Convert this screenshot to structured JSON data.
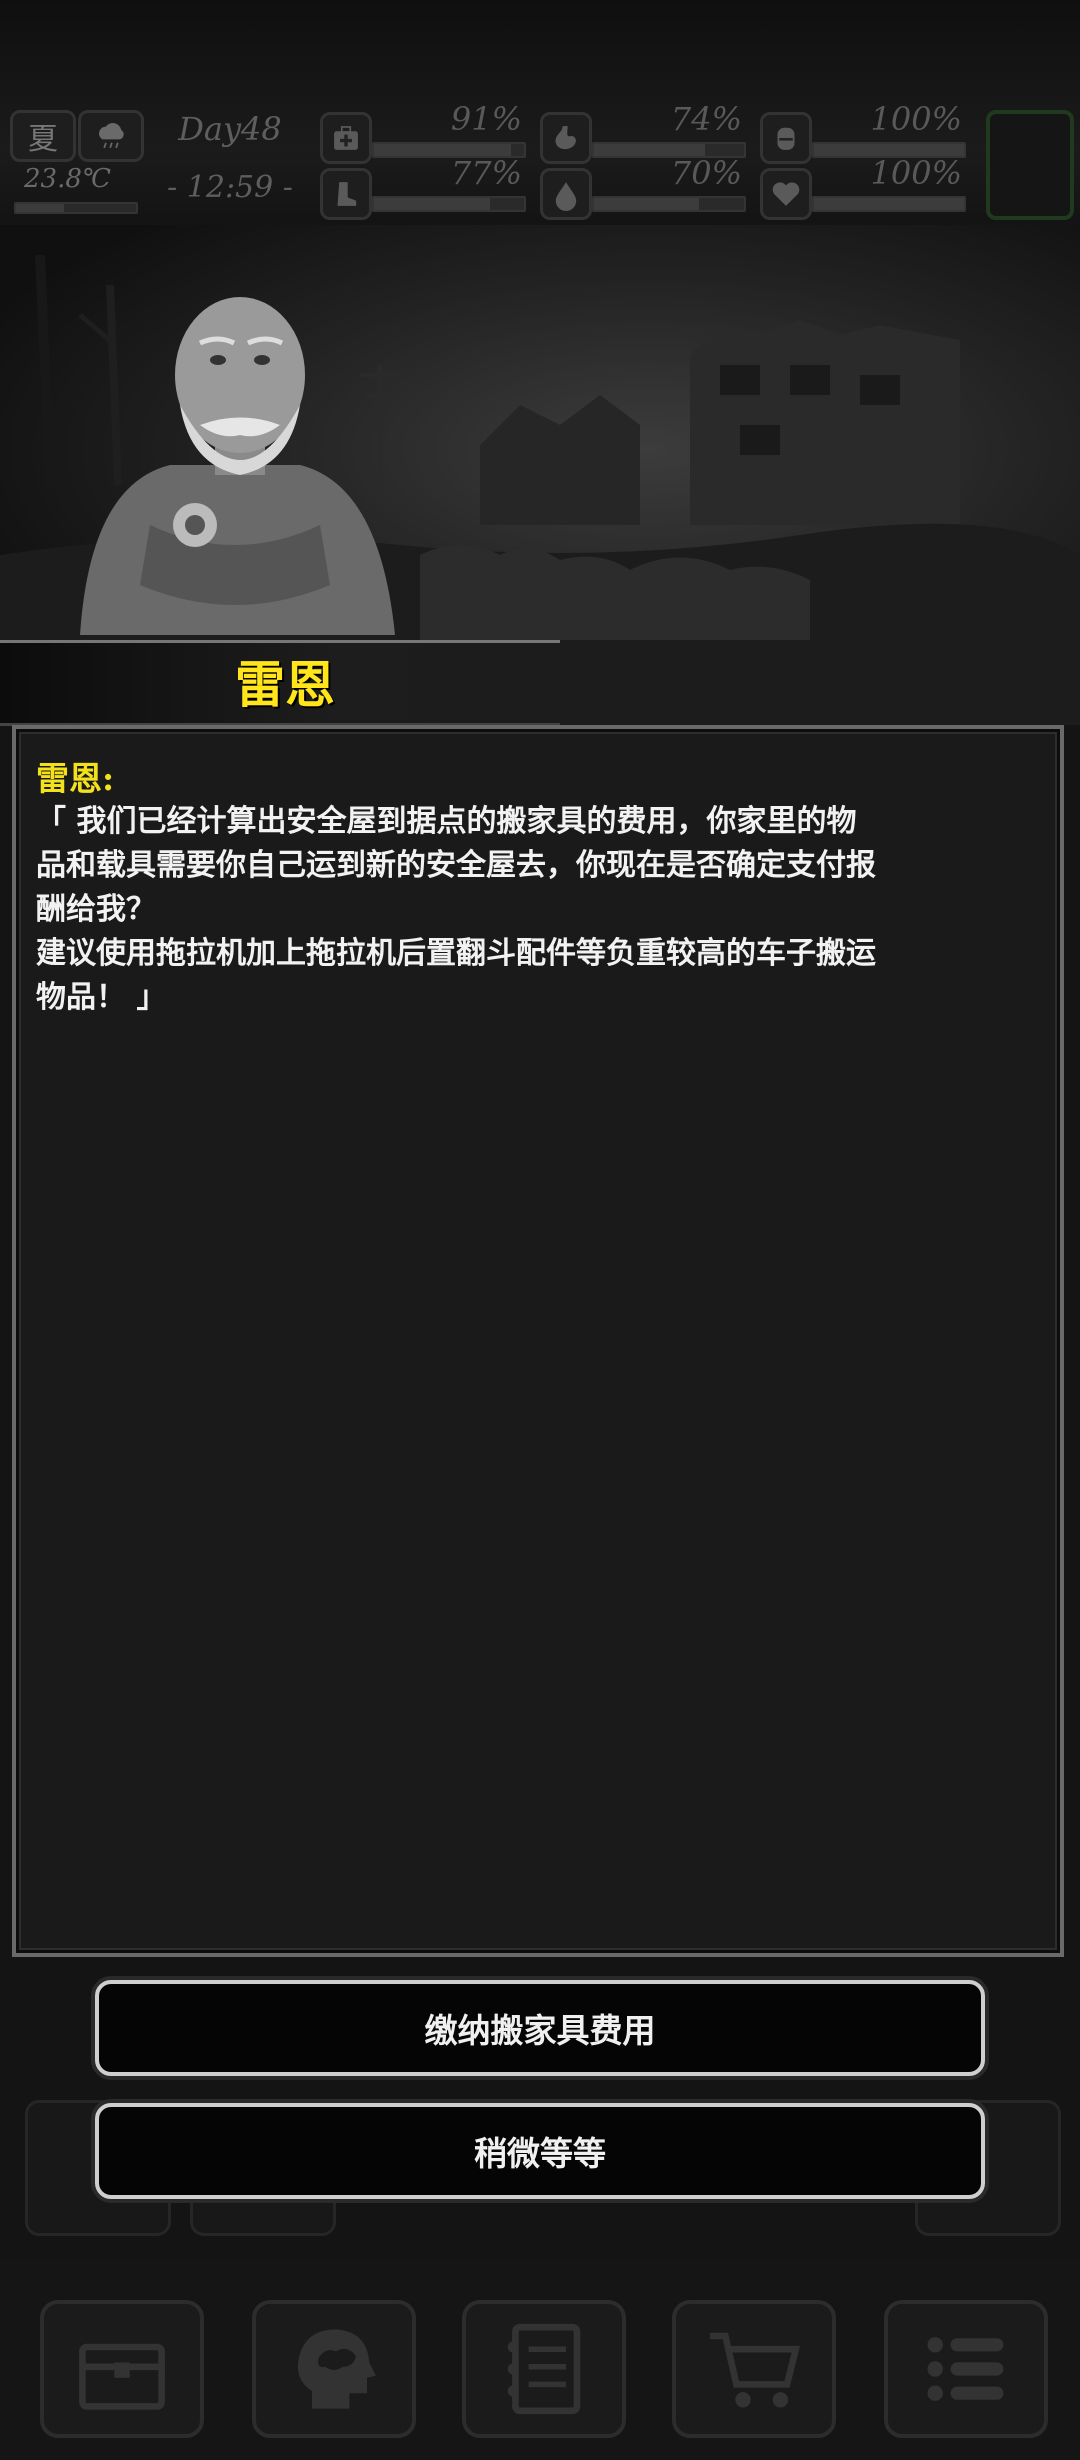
{
  "status": {
    "season": "夏",
    "temperature": "23.8℃",
    "day": "Day48",
    "time": "- 12:59 -",
    "stats": [
      {
        "icon": "medkit-icon",
        "value": "91%",
        "level": 0.91
      },
      {
        "icon": "stomach-icon",
        "value": "74%",
        "level": 0.74
      },
      {
        "icon": "bladder-icon",
        "value": "100%",
        "level": 1.0
      },
      {
        "icon": "boot-icon",
        "value": "77%",
        "level": 0.77
      },
      {
        "icon": "water-drop-icon",
        "value": "70%",
        "level": 0.7
      },
      {
        "icon": "heart-icon",
        "value": "100%",
        "level": 1.0
      }
    ]
  },
  "npc": {
    "name": "雷恩"
  },
  "dialog": {
    "speaker": "雷恩:",
    "lines": [
      "「 我们已经计算出安全屋到据点的搬家具的费用，你家里的物",
      "品和载具需要你自己运到新的安全屋去，你现在是否确定支付报",
      "酬给我？",
      "建议使用拖拉机加上拖拉机后置翻斗配件等负重较高的车子搬运",
      "物品！ 」"
    ]
  },
  "buttons": {
    "pay": "缴纳搬家具费用",
    "wait": "稍微等等"
  },
  "nav": {
    "items": [
      "chest-icon",
      "brain-head-icon",
      "notebook-icon",
      "shopping-cart-icon",
      "menu-list-icon"
    ]
  },
  "colors": {
    "name_yellow": "#ffe51a",
    "speaker_yellow": "#f3e21b",
    "dialog_bg": "#1a1a1a",
    "button_border": "#cfcfcf"
  }
}
